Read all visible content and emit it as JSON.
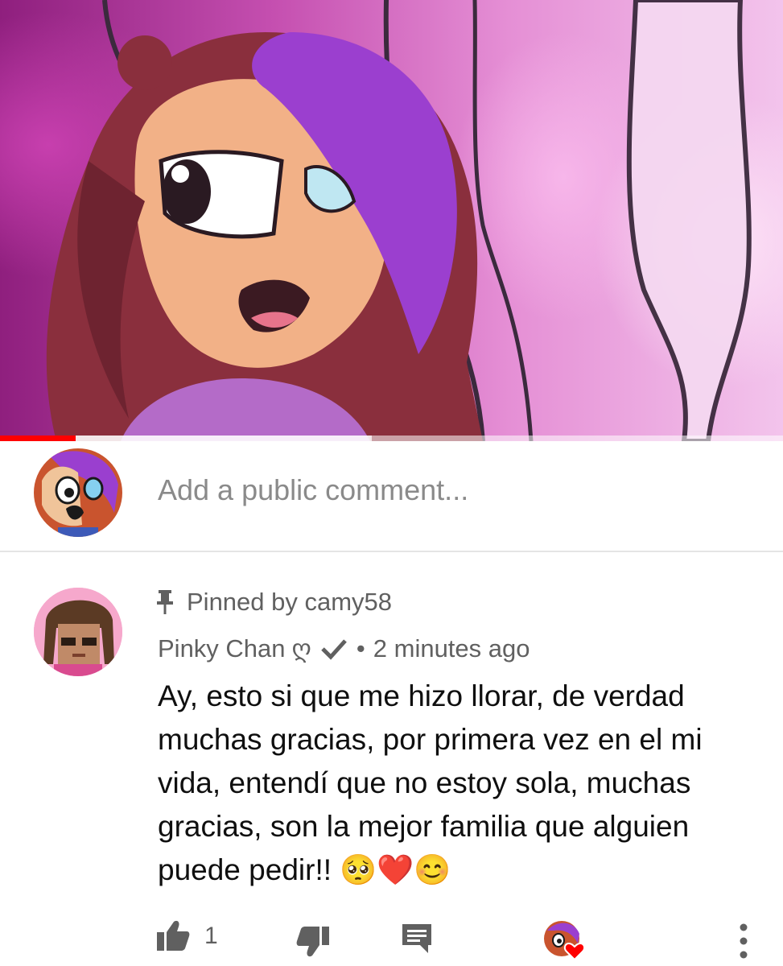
{
  "video": {
    "progress_percent": 9.7,
    "buffered_percent": 47.5
  },
  "add_comment": {
    "placeholder": "Add a public comment..."
  },
  "comment": {
    "pinned_label": "Pinned by camy58",
    "author": "Pinky Chan",
    "author_suffix_glyph": "ღ",
    "verified_icon": "check-icon",
    "separator": "•",
    "timestamp": "2 minutes ago",
    "text": "Ay, esto si que me hizo llorar, de verdad muchas gracias, por primera vez en el mi vida, entendí que no estoy sola, muchas gracias, son la mejor familia que alguien puede pedir!! 🥺❤️😊",
    "like_count": "1",
    "icons": {
      "like": "thumb-up-icon",
      "dislike": "thumb-down-icon",
      "reply": "reply-comment-icon",
      "creator_heart": "creator-heart-icon",
      "more": "more-vertical-icon",
      "pin": "pin-icon"
    }
  },
  "colors": {
    "progress": "#ff0000",
    "secondary_text": "#606060",
    "placeholder_text": "#8a8a8a",
    "heart": "#ff0000"
  }
}
